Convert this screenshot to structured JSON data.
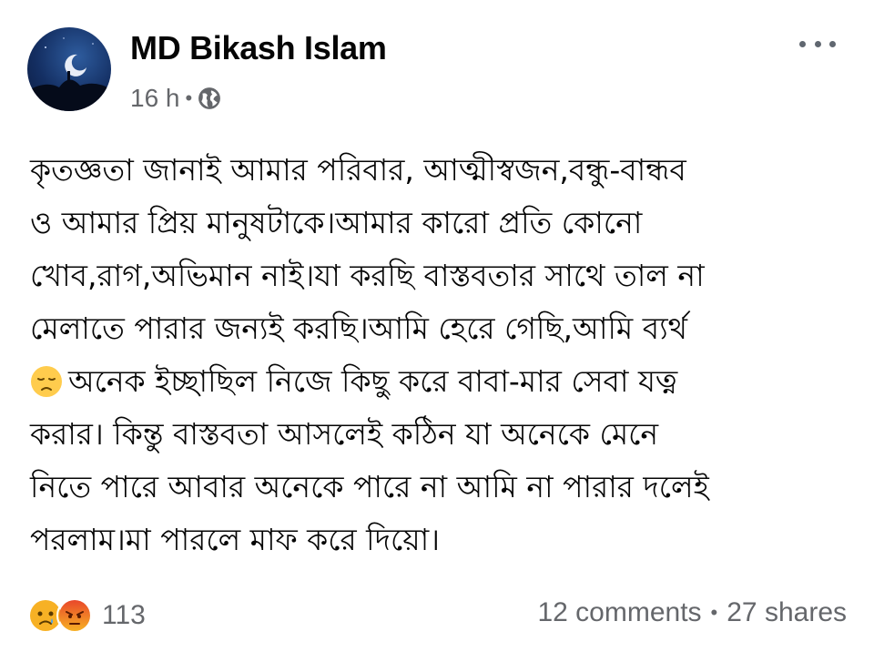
{
  "post": {
    "author": "MD Bikash Islam",
    "time": "16 h",
    "meta_separator": "•",
    "privacy_icon": "globe-icon",
    "menu_icon": "more-horizontal-icon",
    "lines": [
      "কৃতজ্ঞতা জানাই আমার পরিবার, আত্মীস্বজন,বন্ধু-বান্ধব",
      "ও আমার প্রিয় মানুষটাকে।আমার কারো প্রতি কোনো",
      "খোব,রাগ,অভিমান নাই।যা করছি বাস্তবতার সাথে তাল না",
      "মেলাতে পারার জন্যই করছি।আমি হেরে গেছি,আমি ব্যর্থ",
      "অনেক ইচ্ছাছিল নিজে কিছু করে বাবা-মার সেবা যত্ন",
      "করার। কিন্তু বাস্তবতা আসলেই কঠিন যা অনেকে মেনে",
      "নিতে পারে আবার অনেকে পারে না আমি না পারার দলেই",
      "পরলাম।মা পারলে মাফ করে দিয়ো।"
    ],
    "inline_emoji": "disappointed-face-emoji"
  },
  "footer": {
    "reaction_icons": [
      "sad-reaction-icon",
      "angry-reaction-icon"
    ],
    "reaction_count": "113",
    "comments": "12 comments",
    "separator": "•",
    "shares": "27 shares"
  },
  "colors": {
    "text": "#050505",
    "secondary": "#65676b",
    "background": "#ffffff"
  }
}
